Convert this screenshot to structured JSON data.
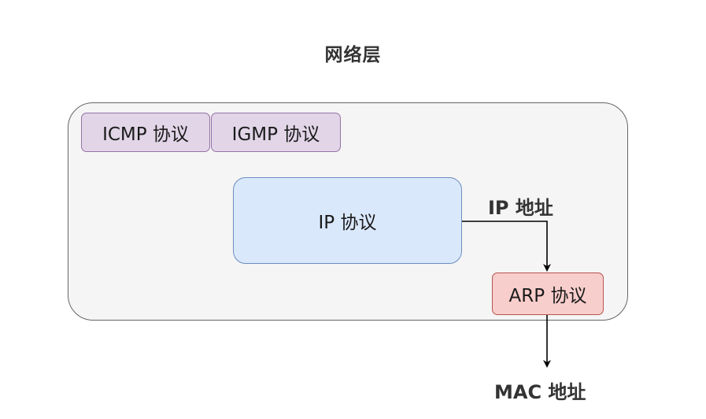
{
  "diagram": {
    "title": "网络层",
    "nodes": {
      "icmp": "ICMP 协议",
      "igmp": "IGMP 协议",
      "ip": "IP 协议",
      "arp": "ARP 协议"
    },
    "edge_labels": {
      "ip_address": "IP 地址",
      "mac_address": "MAC 地址"
    },
    "colors": {
      "container_fill": "#f5f5f5",
      "container_border": "#666666",
      "purple_fill": "#e1d5e7",
      "purple_border": "#9673a6",
      "blue_fill": "#dae8fc",
      "blue_border": "#6c8ebf",
      "red_fill": "#f8cecc",
      "red_border": "#b85450"
    }
  }
}
